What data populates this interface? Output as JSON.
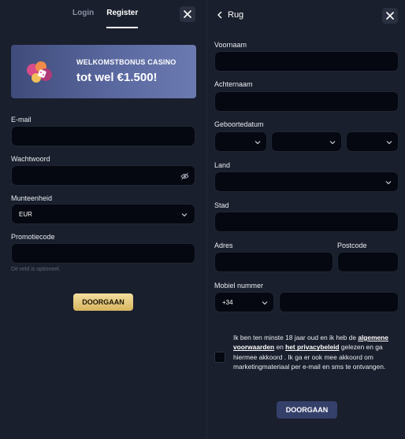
{
  "left": {
    "tabs": [
      {
        "label": "Login",
        "active": false
      },
      {
        "label": "Register",
        "active": true
      }
    ],
    "banner": {
      "line1": "WELKOMSTBONUS CASINO",
      "line2": "tot wel €1.500!"
    },
    "fields": {
      "email_label": "E-mail",
      "email_value": "",
      "password_label": "Wachtwoord",
      "password_value": "",
      "currency_label": "Munteenheid",
      "currency_value": "EUR",
      "promo_label": "Promotiecode",
      "promo_value": "",
      "promo_hint": "Dit veld is optioneel."
    },
    "submit_label": "DOORGAAN"
  },
  "right": {
    "back_label": "Rug",
    "fields": {
      "firstname_label": "Voornaam",
      "lastname_label": "Achternaam",
      "birthdate_label": "Geboortedatum",
      "country_label": "Land",
      "city_label": "Stad",
      "address_label": "Adres",
      "postcode_label": "Postcode",
      "mobile_label": "Mobiel nummer",
      "phone_prefix": "+34"
    },
    "terms": {
      "part1": "Ik ben ten minste 18 jaar oud en ik heb de ",
      "link1": "algemene voorwaarden",
      "part2": " en ",
      "link2": "het privacybeleid",
      "part3": " gelezen en ga hiermee akkoord . Ik ga er ook mee akkoord om marketingmateriaal per e-mail en sms te ontvangen."
    },
    "submit_label": "DOORGAAN"
  },
  "icons": {
    "close": "close-icon",
    "back": "chevron-left-icon",
    "dropdown": "chevron-down-icon",
    "password_toggle": "eye-off-icon"
  },
  "colors": {
    "background": "#131824",
    "panel": "#1a1f2d",
    "input": "#050810",
    "banner": "#5a68a0",
    "gold_button": "#e5c77c",
    "secondary_button": "#35406a"
  }
}
